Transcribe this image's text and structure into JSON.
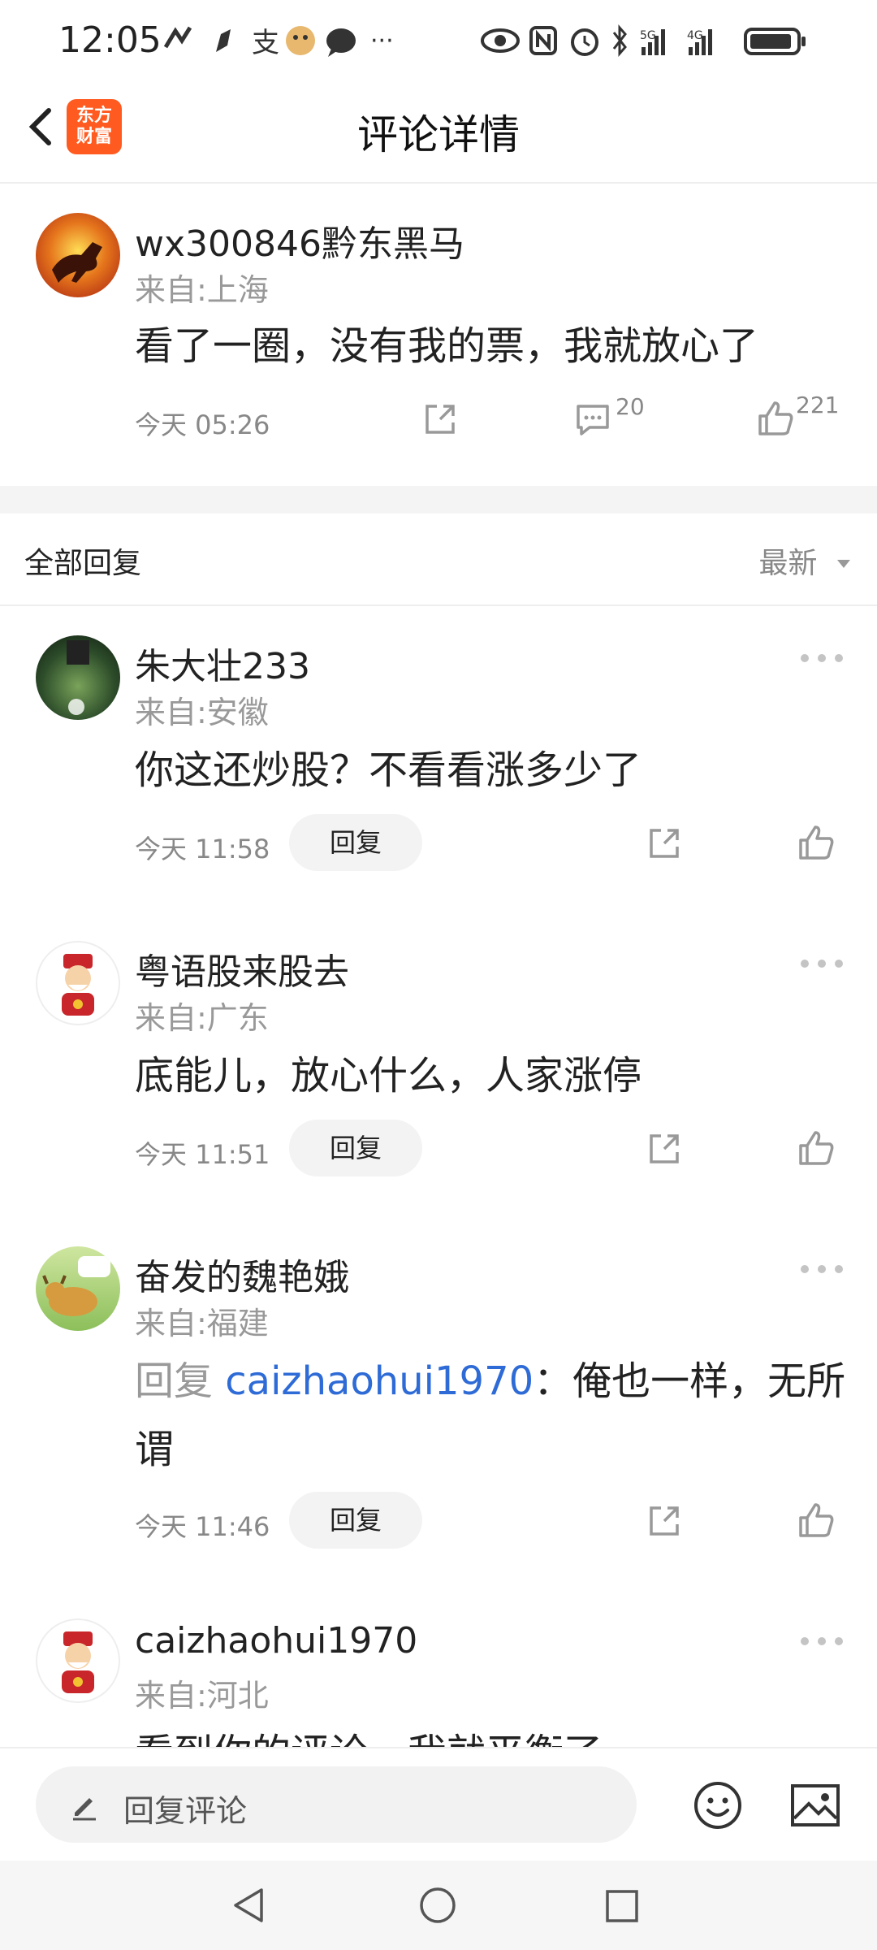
{
  "status_bar": {
    "time": "12:05",
    "more": "···",
    "net1": "5G",
    "net2": "4G"
  },
  "header": {
    "title": "评论详情",
    "logo_line1": "东方",
    "logo_line2": "财富"
  },
  "post": {
    "username": "wx300846黔东黑马",
    "location": "来自:上海",
    "content": "看了一圈，没有我的票，我就放心了",
    "time": "今天 05:26",
    "comment_count": "20",
    "like_count": "221"
  },
  "replies_header": {
    "label": "全部回复",
    "sort_label": "最新"
  },
  "replies": [
    {
      "username": "朱大壮233",
      "location": "来自:安徽",
      "content": "你这还炒股？不看看涨多少了",
      "time": "今天 11:58",
      "reply_label": "回复"
    },
    {
      "username": "粤语股来股去",
      "location": "来自:广东",
      "content": "底能儿，放心什么，人家涨停",
      "time": "今天 11:51",
      "reply_label": "回复"
    },
    {
      "username": "奋发的魏艳娥",
      "location": "来自:福建",
      "reply_prefix": "回复 ",
      "reply_to": "caizhaohui1970",
      "content": "：俺也一样，无所谓",
      "time": "今天 11:46",
      "reply_label": "回复"
    },
    {
      "username": "caizhaohui1970",
      "location": "来自:河北",
      "content": "看到你的评论，我就平衡了"
    }
  ],
  "input_bar": {
    "placeholder": "回复评论"
  },
  "colors": {
    "brand": "#ff5a1f",
    "link": "#2e6bd6",
    "muted": "#999999"
  }
}
